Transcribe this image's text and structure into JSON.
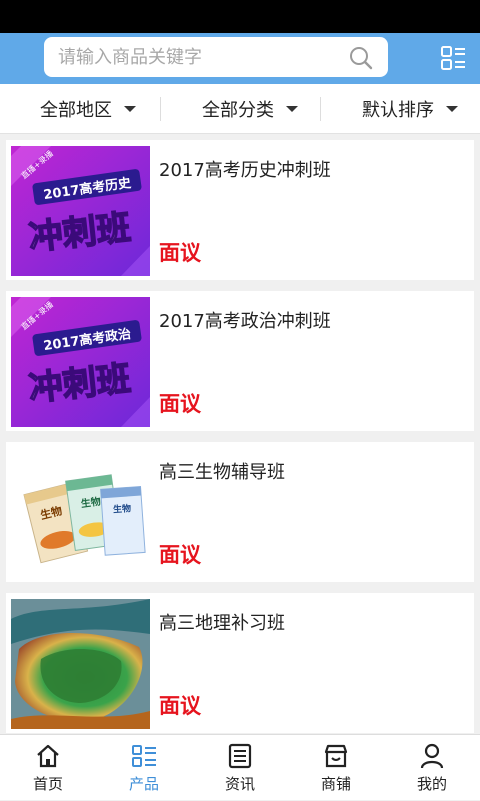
{
  "search": {
    "placeholder": "请输入商品关键字",
    "value": ""
  },
  "filters": [
    {
      "label": "全部地区"
    },
    {
      "label": "全部分类"
    },
    {
      "label": "默认排序"
    }
  ],
  "products": [
    {
      "title": "2017高考历史冲刺班",
      "price": "面议",
      "thumb": {
        "banner": "2017高考历史",
        "main": "冲刺班",
        "tag": "直播+录播"
      }
    },
    {
      "title": "2017高考政治冲刺班",
      "price": "面议",
      "thumb": {
        "banner": "2017高考政治",
        "main": "冲刺班",
        "tag": "直播+录播"
      }
    },
    {
      "title": "高三生物辅导班",
      "price": "面议",
      "thumb": {
        "book": "生物"
      }
    },
    {
      "title": "高三地理补习班",
      "price": "面议"
    }
  ],
  "tabs": [
    {
      "label": "首页",
      "icon": "home-icon"
    },
    {
      "label": "产品",
      "icon": "products-icon",
      "active": true
    },
    {
      "label": "资讯",
      "icon": "news-icon"
    },
    {
      "label": "商铺",
      "icon": "shop-icon"
    },
    {
      "label": "我的",
      "icon": "user-icon"
    }
  ],
  "colors": {
    "header": "#60a9e8",
    "price": "#e6141e",
    "tab_active": "#3f8fd8"
  }
}
